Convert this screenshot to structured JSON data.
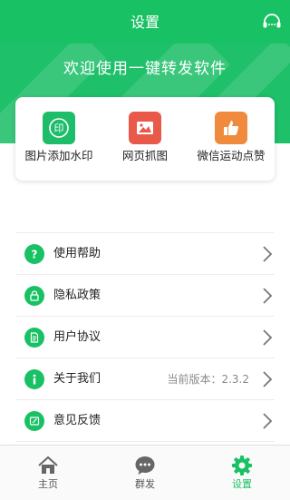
{
  "header": {
    "title": "设置",
    "service_icon": "customer-service-icon"
  },
  "banner": {
    "welcome": "欢迎使用一键转发软件"
  },
  "features": [
    {
      "label": "图片添加水印",
      "icon": "watermark-icon",
      "color": "#1dbd6a",
      "glyph": "印"
    },
    {
      "label": "网页抓图",
      "icon": "image-icon",
      "color": "#e8594a"
    },
    {
      "label": "微信运动点赞",
      "icon": "thumbs-up-icon",
      "color": "#f08a3c"
    }
  ],
  "menu": [
    {
      "label": "使用帮助",
      "icon": "question-icon",
      "value": ""
    },
    {
      "label": "隐私政策",
      "icon": "lock-icon",
      "value": ""
    },
    {
      "label": "用户协议",
      "icon": "document-icon",
      "value": ""
    },
    {
      "label": "关于我们",
      "icon": "info-icon",
      "value": "当前版本：2.3.2"
    },
    {
      "label": "意见反馈",
      "icon": "feedback-icon",
      "value": ""
    }
  ],
  "tabs": [
    {
      "label": "主页",
      "icon": "home-icon",
      "active": false
    },
    {
      "label": "群发",
      "icon": "chat-icon",
      "active": false
    },
    {
      "label": "设置",
      "icon": "gear-icon",
      "active": true
    }
  ],
  "colors": {
    "primary": "#18c163",
    "banner": "#1fc06a",
    "muted": "#8a8a8a"
  }
}
